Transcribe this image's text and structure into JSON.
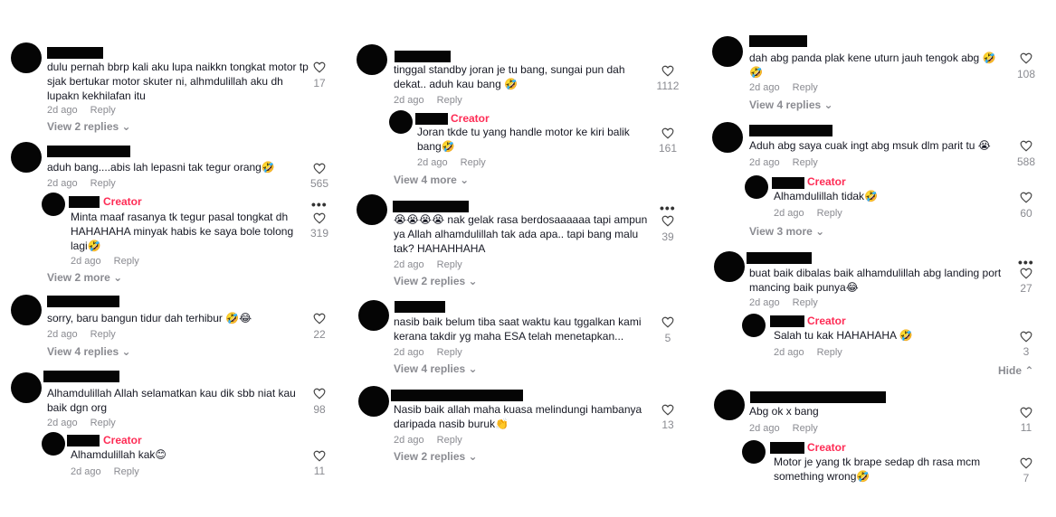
{
  "icons": {
    "heart": "heart-outline-icon",
    "chevron": "chevron-down-icon",
    "more": "more-dots-icon"
  },
  "colors": {
    "creator": "#fe2c55",
    "muted": "#8a8b91",
    "redaction": "#050505"
  },
  "col1": {
    "c1": {
      "text": "dulu pernah bbrp kali aku lupa naikkn tongkat motor tp sjak bertukar motor skuter ni, alhmdulillah aku dh lupakn kekhilafan itu",
      "time": "2d ago",
      "reply": "Reply",
      "likes": "17",
      "view": "View 2 replies"
    },
    "c2": {
      "text": "aduh bang....abis lah lepasni tak tegur orang🤣",
      "time": "2d ago",
      "reply": "Reply",
      "likes": "565"
    },
    "c2r": {
      "creator": "Creator",
      "text": "Minta maaf rasanya tk tegur pasal tongkat dh HAHAHAHA minyak habis ke saya bole tolong lagi🤣",
      "time": "2d ago",
      "reply": "Reply",
      "likes": "319",
      "view": "View 2 more"
    },
    "c3": {
      "text": "sorry, baru bangun tidur dah terhibur 🤣😂",
      "time": "2d ago",
      "reply": "Reply",
      "likes": "22",
      "view": "View 4 replies"
    },
    "c4": {
      "text": "Alhamdulillah Allah selamatkan kau dik sbb niat kau baik dgn org",
      "time": "2d ago",
      "reply": "Reply",
      "likes": "98"
    },
    "c4r": {
      "creator": "Creator",
      "text": "Alhamdulillah kak😊",
      "time": "2d ago",
      "reply": "Reply",
      "likes": "11"
    }
  },
  "col2": {
    "c1": {
      "text": "tinggal standby joran je tu bang, sungai pun dah dekat.. aduh kau bang 🤣",
      "time": "2d ago",
      "reply": "Reply",
      "likes": "1112"
    },
    "c1r": {
      "creator": "Creator",
      "text": "Joran tkde tu yang handle motor ke kiri balik bang🤣",
      "time": "2d ago",
      "reply": "Reply",
      "likes": "161",
      "view": "View 4 more"
    },
    "c2": {
      "text": "😭😭😭😭 nak gelak rasa berdosaaaaaa tapi ampun ya Allah alhamdulillah tak ada apa.. tapi bang malu tak? HAHAHHAHA",
      "time": "2d ago",
      "reply": "Reply",
      "likes": "39",
      "view": "View 2 replies"
    },
    "c3": {
      "text": "nasib baik belum tiba saat waktu kau tggalkan kami kerana takdir yg maha ESA telah menetapkan...",
      "time": "2d ago",
      "reply": "Reply",
      "likes": "5",
      "view": "View 4 replies"
    },
    "c4": {
      "text": "Nasib baik allah maha kuasa melindungi hambanya daripada nasib buruk👏",
      "time": "2d ago",
      "reply": "Reply",
      "likes": "13",
      "view": "View 2 replies"
    }
  },
  "col3": {
    "c1": {
      "text": "dah abg panda plak kene uturn jauh tengok abg 🤣🤣",
      "time": "2d ago",
      "reply": "Reply",
      "likes": "108",
      "view": "View 4 replies"
    },
    "c2": {
      "text": "Aduh abg saya cuak ingt abg msuk dlm parit tu 😭",
      "time": "2d ago",
      "reply": "Reply",
      "likes": "588"
    },
    "c2r": {
      "creator": "Creator",
      "text": "Alhamdulillah tidak🤣",
      "time": "2d ago",
      "reply": "Reply",
      "likes": "60",
      "view": "View 3 more"
    },
    "c3": {
      "text": "buat baik dibalas baik alhamdulillah abg landing port mancing baik punya😂",
      "time": "2d ago",
      "reply": "Reply",
      "likes": "27"
    },
    "c3r": {
      "creator": "Creator",
      "text": "Salah tu kak HAHAHAHA 🤣",
      "time": "2d ago",
      "reply": "Reply",
      "likes": "3",
      "hide": "Hide"
    },
    "c4": {
      "text": "Abg ok x bang",
      "time": "2d ago",
      "reply": "Reply",
      "likes": "11"
    },
    "c4r": {
      "creator": "Creator",
      "text": "Motor je yang tk brape sedap dh rasa mcm something wrong🤣",
      "time": "2d ago",
      "reply": "Reply",
      "likes": "7"
    }
  }
}
